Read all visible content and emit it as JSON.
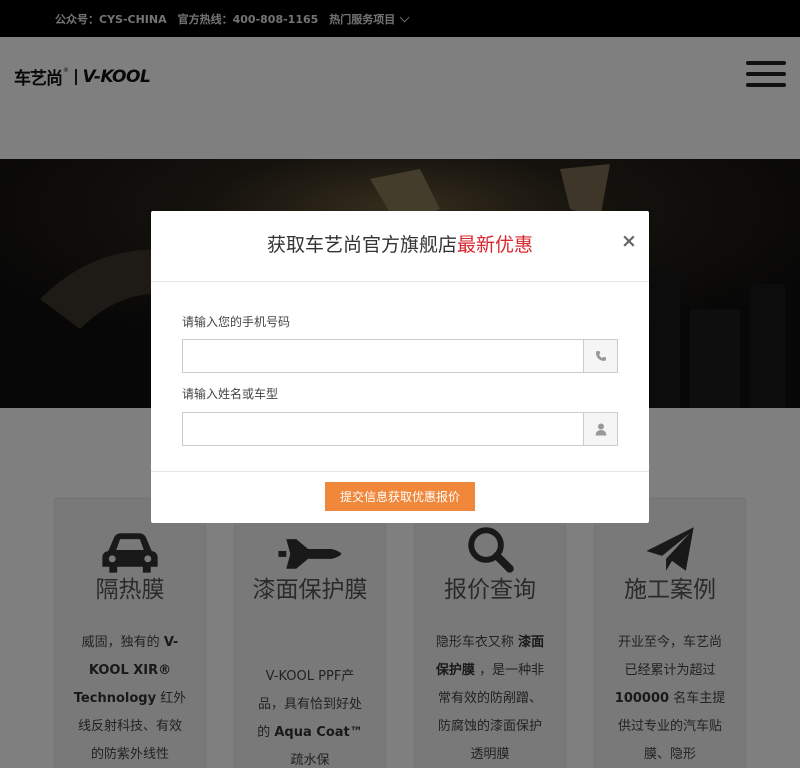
{
  "topbar": {
    "wechat": "公众号：CYS-CHINA",
    "hotline": "官方热线：400-808-1165",
    "services": "热门服务项目"
  },
  "logo": {
    "cn": "车艺尚",
    "reg": "®",
    "en": "V-KOOL"
  },
  "features": [
    {
      "icon": "car-icon",
      "title": "隔热膜",
      "desc": [
        "威固，独有的 ",
        "V-KOOL XIR® Technology",
        " 红外线反射科技、有效的防紫外线性"
      ]
    },
    {
      "icon": "space-shuttle-icon",
      "title": "漆面保护膜",
      "desc": [
        "V-KOOL PPF产品，具有恰到好处的 ",
        "Aqua Coat™",
        " 疏水保"
      ]
    },
    {
      "icon": "search-icon",
      "title": "报价查询",
      "desc": [
        "隐形车衣又称 ",
        "漆面保护膜",
        " ，是一种非常有效的防剐蹭、防腐蚀的漆面保护透明膜"
      ]
    },
    {
      "icon": "paper-plane-icon",
      "title": "施工案例",
      "desc": [
        "开业至今，车艺尚已经累计为超过 ",
        "100000",
        " 名车主提供过专业的汽车贴膜、隐形"
      ]
    }
  ],
  "modal": {
    "title_prefix": "获取车艺尚官方旗舰店",
    "title_highlight": "最新优惠",
    "close": "×",
    "phone_label": "请输入您的手机号码",
    "phone_value": "",
    "name_label": "请输入姓名或车型",
    "name_value": "",
    "submit": "提交信息获取优惠报价",
    "accent_color": "#d9282f",
    "button_color": "#f0873a"
  }
}
